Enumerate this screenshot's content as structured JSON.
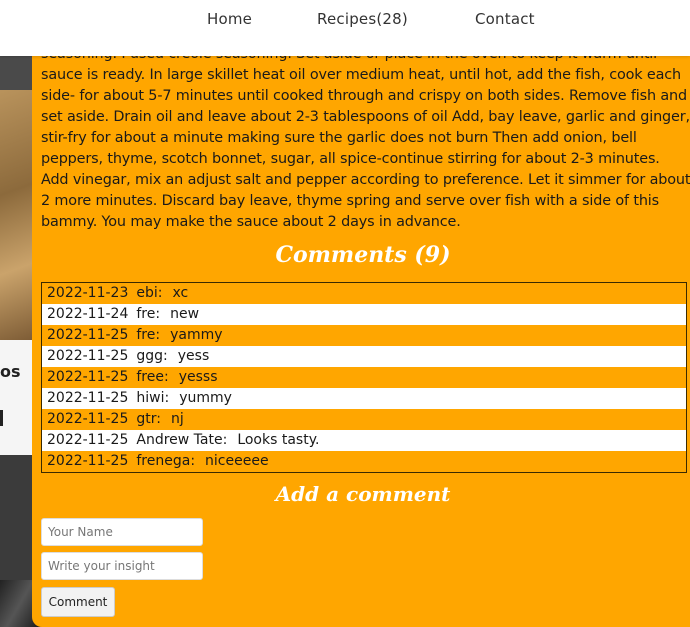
{
  "nav": {
    "home": "Home",
    "recipes": "Recipes(28)",
    "contact": "Contact"
  },
  "background": {
    "band_text": "os"
  },
  "recipe": {
    "instructions_line0": "seasoning. I used creole seasoning. Set aside or place in the oven to keep it warm until",
    "instructions": "sauce is ready. In large skillet heat oil over medium heat, until hot, add the fish, cook each side- for about 5-7 minutes until cooked through and crispy on both sides. Remove fish and set aside. Drain oil and leave about 2-3 tablespoons of oil Add, bay leave, garlic and ginger, stir-fry for about a minute making sure the garlic does not burn Then add onion, bell peppers, thyme, scotch bonnet, sugar, all spice-continue stirring for about 2-3 minutes. Add vinegar, mix an adjust salt and pepper according to preference. Let it simmer for about 2 more minutes. Discard bay leave, thyme spring and serve over fish with a side of this bammy. You may make the sauce about 2 days in advance."
  },
  "comments": {
    "title": "Comments (9)",
    "items": [
      {
        "date": "2022-11-23",
        "name": "ebi:",
        "text": "xc"
      },
      {
        "date": "2022-11-24",
        "name": "fre:",
        "text": "new"
      },
      {
        "date": "2022-11-25",
        "name": "fre:",
        "text": "yammy"
      },
      {
        "date": "2022-11-25",
        "name": "ggg:",
        "text": "yess"
      },
      {
        "date": "2022-11-25",
        "name": "free:",
        "text": "yesss"
      },
      {
        "date": "2022-11-25",
        "name": "hiwi:",
        "text": "yummy"
      },
      {
        "date": "2022-11-25",
        "name": "gtr:",
        "text": "nj"
      },
      {
        "date": "2022-11-25",
        "name": "Andrew Tate:",
        "text": "Looks tasty."
      },
      {
        "date": "2022-11-25",
        "name": "frenega:",
        "text": "niceeeee"
      }
    ]
  },
  "form": {
    "title": "Add a comment",
    "name_placeholder": "Your Name",
    "insight_placeholder": "Write your insight",
    "submit_label": "Comment"
  },
  "colors": {
    "modal_bg": "#ffa600",
    "row_alt": "#ffffff",
    "heading": "#ffffff"
  }
}
